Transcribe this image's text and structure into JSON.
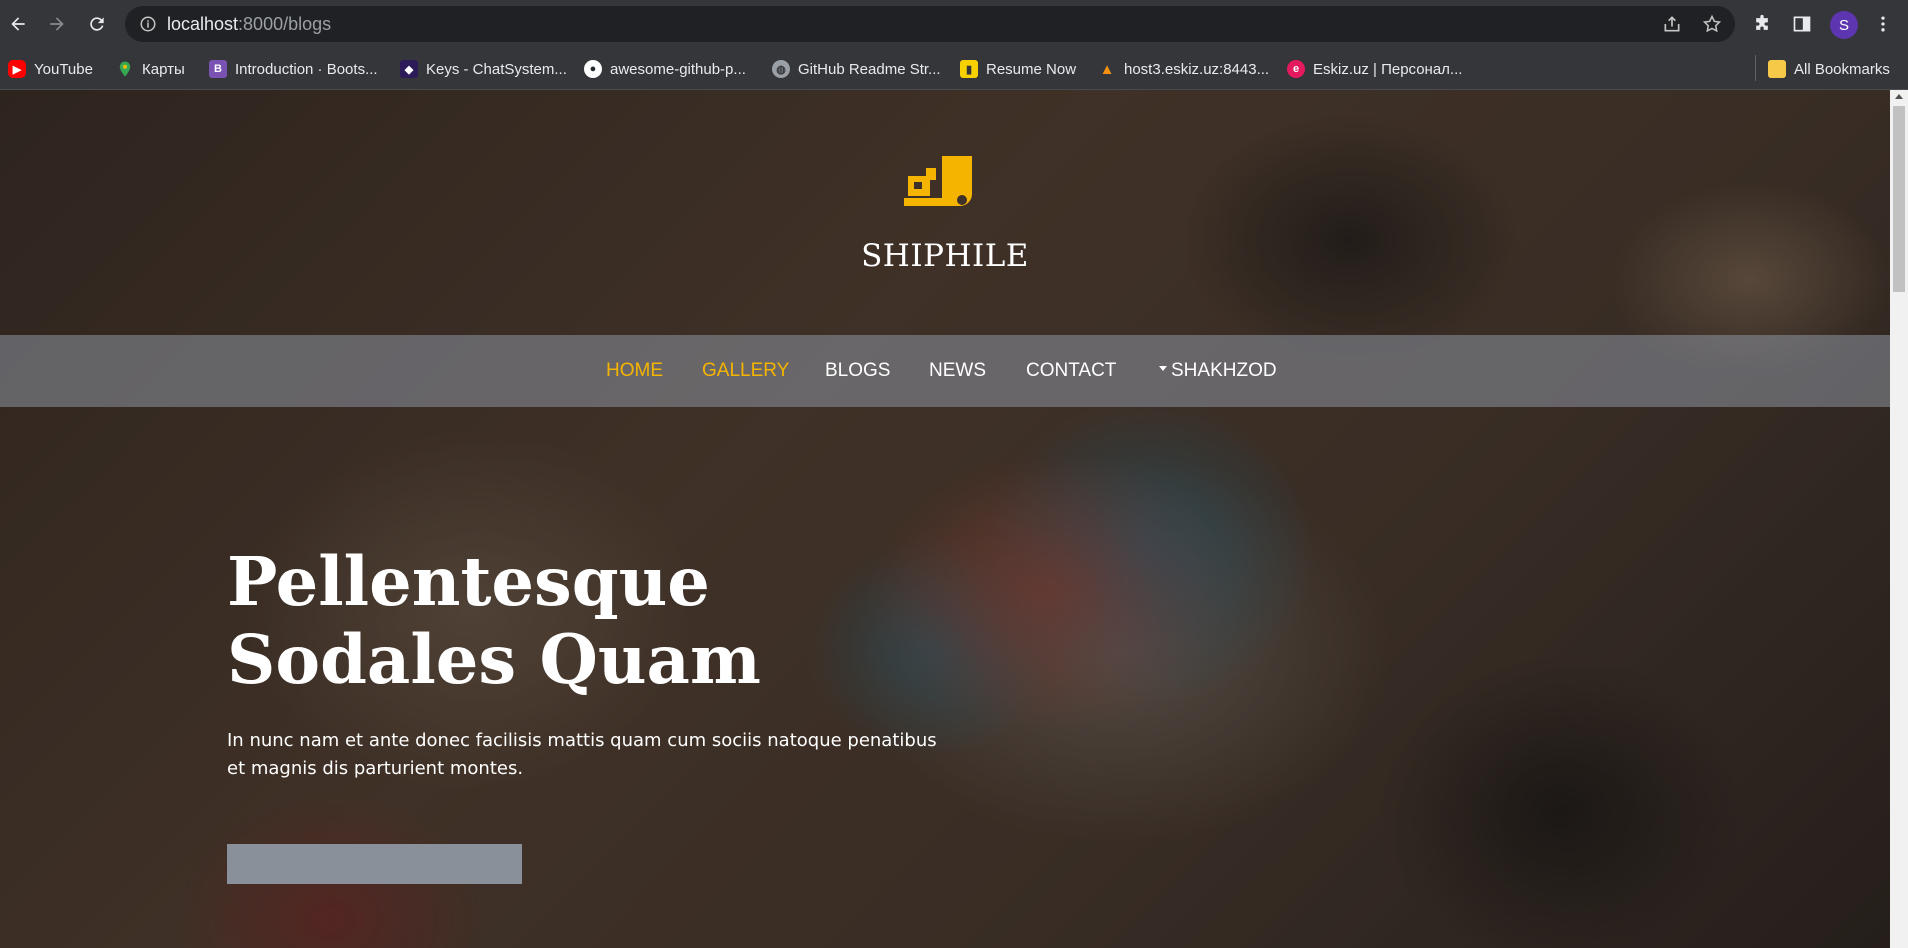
{
  "browser": {
    "url_host": "localhost",
    "url_rest": ":8000/blogs",
    "profile_initial": "S",
    "bookmarks": [
      {
        "label": "YouTube",
        "icon": "youtube-icon",
        "color": "#ff0000"
      },
      {
        "label": "Карты",
        "icon": "maps-pin-icon",
        "color": "#34a853"
      },
      {
        "label": "Introduction · Boots...",
        "icon": "bootstrap-icon",
        "color": "#7952b3"
      },
      {
        "label": "Keys - ChatSystem...",
        "icon": "cube-icon",
        "color": "#4b2d8f"
      },
      {
        "label": "awesome-github-p...",
        "icon": "github-icon",
        "color": "#ffffff"
      },
      {
        "label": "GitHub Readme Str...",
        "icon": "globe-icon",
        "color": "#bdc1c6"
      },
      {
        "label": "Resume Now",
        "icon": "resume-icon",
        "color": "#f7d000"
      },
      {
        "label": "host3.eskiz.uz:8443...",
        "icon": "plesk-icon",
        "color": "#f29111"
      },
      {
        "label": "Eskiz.uz | Персонал...",
        "icon": "eskiz-icon",
        "color": "#e5195e"
      }
    ],
    "all_bookmarks_label": "All Bookmarks"
  },
  "site": {
    "name": "SHIPHILE",
    "brand_color": "#f5b400",
    "nav": [
      {
        "label": "HOME",
        "active": true
      },
      {
        "label": "GALLERY",
        "active": true
      },
      {
        "label": "BLOGS",
        "active": false
      },
      {
        "label": "NEWS",
        "active": false
      },
      {
        "label": "CONTACT",
        "active": false
      },
      {
        "label": "SHAKHZOD",
        "active": false,
        "dropdown": true
      }
    ]
  },
  "hero": {
    "title": "Pellentesque Sodales Quam",
    "text": "In nunc nam et ante donec facilisis mattis quam cum sociis natoque penatibus et magnis dis parturient montes."
  }
}
